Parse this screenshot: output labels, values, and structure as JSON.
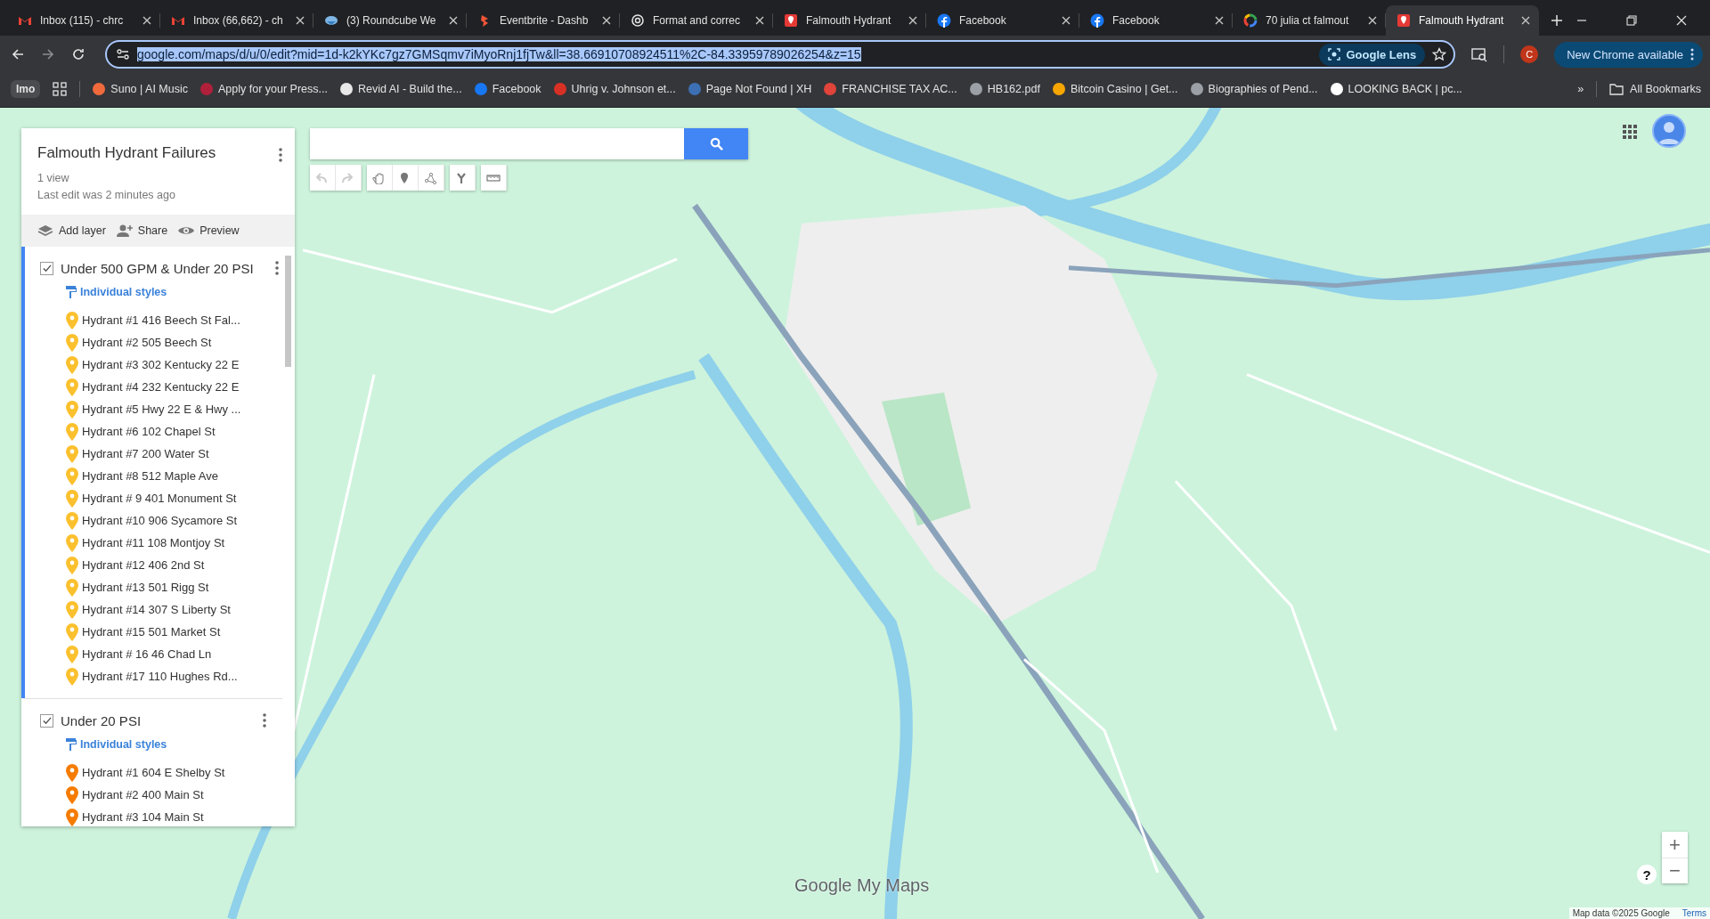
{
  "browser": {
    "tabs": [
      {
        "title": "Inbox (115) - chrc",
        "kind": "mail",
        "selected": false
      },
      {
        "title": "Inbox (66,662) - ch",
        "kind": "mail",
        "selected": false
      },
      {
        "title": "(3) Roundcube We",
        "kind": "cloud",
        "selected": false
      },
      {
        "title": "Eventbrite - Dashb",
        "kind": "flame",
        "selected": false
      },
      {
        "title": "Format and correc",
        "kind": "knot",
        "selected": false
      },
      {
        "title": "Falmouth Hydrant",
        "kind": "pin",
        "selected": false
      },
      {
        "title": "Facebook",
        "kind": "f",
        "selected": false
      },
      {
        "title": "Facebook",
        "kind": "f",
        "selected": false
      },
      {
        "title": "70 julia ct falmout",
        "kind": "g",
        "selected": false
      },
      {
        "title": "Falmouth Hydrant",
        "kind": "pin",
        "selected": true
      }
    ],
    "url": "google.com/maps/d/u/0/edit?mid=1d-k2kYKc7gz7GMSqmv7iMyoRnj1fjTw&ll=38.66910708924511%2C-84.33959789026254&z=15",
    "lens_button": "Google Lens",
    "profile_initial": "C",
    "update_button": "New Chrome available",
    "profile_chip": "Imo",
    "bookmarks": [
      {
        "title": "Suno | AI Music",
        "color": "#f06a3c"
      },
      {
        "title": "Apply for your Press...",
        "color": "#b0203a"
      },
      {
        "title": "Revid AI - Build the...",
        "color": "#e8e8e8"
      },
      {
        "title": "Facebook",
        "color": "#1877f2"
      },
      {
        "title": "Uhrig v. Johnson et...",
        "color": "#d93025"
      },
      {
        "title": "Page Not Found | XH",
        "color": "#3c6fb4"
      },
      {
        "title": "FRANCHISE TAX AC...",
        "color": "#e0443a"
      },
      {
        "title": "HB162.pdf",
        "color": "#9aa0a6"
      },
      {
        "title": "Bitcoin Casino | Get...",
        "color": "#f7a600"
      },
      {
        "title": "Biographies of Pend...",
        "color": "#9aa0a6"
      },
      {
        "title": "LOOKING BACK | pc...",
        "color": "#ffffff"
      }
    ],
    "more_bookmarks": "»",
    "all_bookmarks": "All Bookmarks"
  },
  "map": {
    "title": "Falmouth Hydrant Failures",
    "views": "1 view",
    "last_edit": "Last edit was 2 minutes ago",
    "actions": [
      "Add layer",
      "Share",
      "Preview"
    ],
    "layers": [
      {
        "name": "Under 500 GPM & Under 20 PSI",
        "checked": true,
        "selected": true,
        "style": "Individual styles",
        "color": "#fbc02d",
        "items": [
          "Hydrant #1 416 Beech St Fal...",
          "Hydrant #2 505 Beech St",
          "Hydrant #3 302 Kentucky 22 E",
          "Hydrant #4 232 Kentucky 22 E",
          "Hydrant #5 Hwy 22 E & Hwy ...",
          "Hydrant #6 102 Chapel St",
          "Hydrant #7 200 Water St",
          "Hydrant #8 512 Maple Ave",
          "Hydrant # 9 401 Monument St",
          "Hydrant #10 906 Sycamore St",
          "Hydrant #11 108 Montjoy St",
          "Hydrant #12 406 2nd St",
          "Hydrant #13 501 Rigg St",
          "Hydrant #14 307 S Liberty St",
          "Hydrant #15 501 Market St",
          "Hydrant # 16 46 Chad Ln",
          "Hydrant #17 110 Hughes Rd..."
        ]
      },
      {
        "name": "Under 20 PSI",
        "checked": true,
        "selected": false,
        "style": "Individual styles",
        "color": "#f57c00",
        "items": [
          "Hydrant #1 604 E Shelby St",
          "Hydrant #2 400 Main St",
          "Hydrant #3 104 Main St"
        ]
      }
    ],
    "logo": "Google My Maps",
    "help": "?",
    "zoom_in": "+",
    "zoom_out": "−",
    "attribution": "Map data ©2025 Google",
    "terms": "Terms"
  }
}
